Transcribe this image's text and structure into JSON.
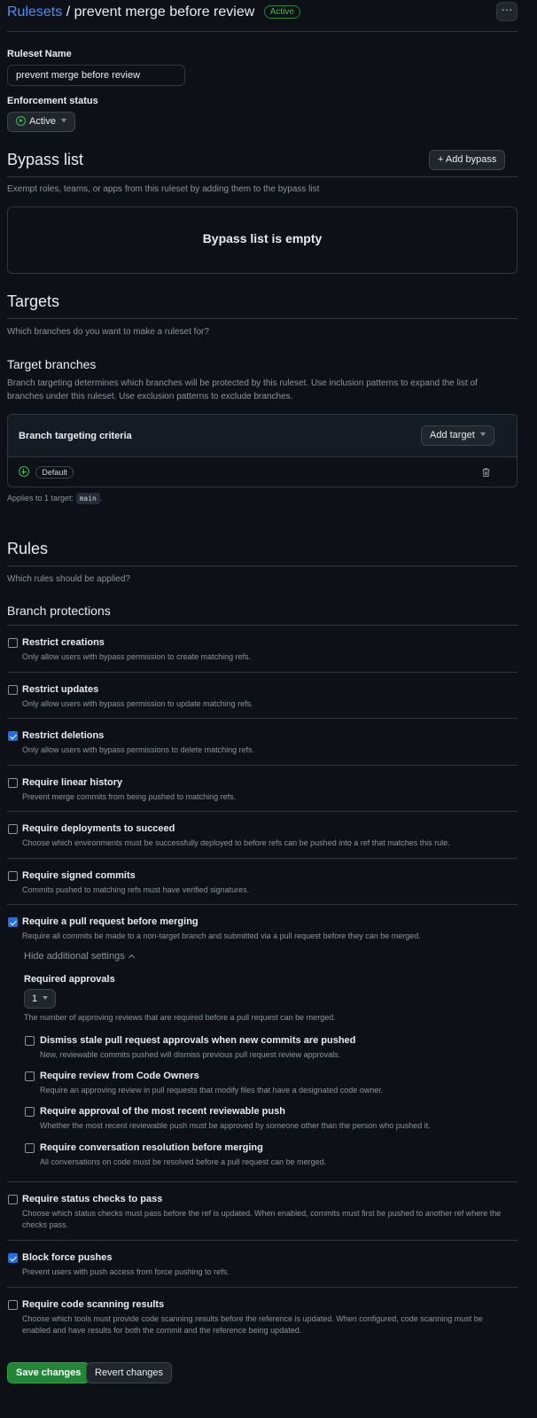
{
  "header": {
    "breadcrumb_link": "Rulesets",
    "separator": "/",
    "ruleset_title": "prevent merge before review",
    "status_badge": "Active",
    "more_icon": "kebab-horizontal-icon"
  },
  "name_section": {
    "label": "Ruleset Name",
    "value": "prevent merge before review"
  },
  "enforcement": {
    "label": "Enforcement status",
    "selected": "Active"
  },
  "bypass": {
    "title": "Bypass list",
    "add_button": "+ Add bypass",
    "description": "Exempt roles, teams, or apps from this ruleset by adding them to the bypass list",
    "empty_text": "Bypass list is empty"
  },
  "targets": {
    "title": "Targets",
    "description": "Which branches do you want to make a ruleset for?",
    "branches_title": "Target branches",
    "branches_description": "Branch targeting determines which branches will be protected by this ruleset. Use inclusion patterns to expand the list of branches under this ruleset. Use exclusion patterns to exclude branches.",
    "criteria_label": "Branch targeting criteria",
    "add_target_button": "Add target",
    "default_pill": "Default",
    "applies_prefix": "Applies to 1 target:",
    "applies_code": "main",
    "applies_suffix": "."
  },
  "rules": {
    "title": "Rules",
    "description": "Which rules should be applied?",
    "protections_title": "Branch protections",
    "items": [
      {
        "title": "Restrict creations",
        "description": "Only allow users with bypass permission to create matching refs.",
        "checked": false
      },
      {
        "title": "Restrict updates",
        "description": "Only allow users with bypass permission to update matching refs.",
        "checked": false
      },
      {
        "title": "Restrict deletions",
        "description": "Only allow users with bypass permissions to delete matching refs.",
        "checked": true
      },
      {
        "title": "Require linear history",
        "description": "Prevent merge commits from being pushed to matching refs.",
        "checked": false
      },
      {
        "title": "Require deployments to succeed",
        "description": "Choose which environments must be successfully deployed to before refs can be pushed into a ref that matches this rule.",
        "checked": false
      },
      {
        "title": "Require signed commits",
        "description": "Commits pushed to matching refs must have verified signatures.",
        "checked": false
      },
      {
        "title": "Require a pull request before merging",
        "description": "Require all commits be made to a non-target branch and submitted via a pull request before they can be merged.",
        "checked": true
      },
      {
        "title": "Require status checks to pass",
        "description": "Choose which status checks must pass before the ref is updated. When enabled, commits must first be pushed to another ref where the checks pass.",
        "checked": false
      },
      {
        "title": "Block force pushes",
        "description": "Prevent users with push access from force pushing to refs.",
        "checked": true
      },
      {
        "title": "Require code scanning results",
        "description": "Choose which tools must provide code scanning results before the reference is updated. When configured, code scanning must be enabled and have results for both the commit and the reference being updated.",
        "checked": false
      }
    ],
    "pr_settings": {
      "toggle_label": "Hide additional settings",
      "approvals_label": "Required approvals",
      "approvals_value": "1",
      "approvals_description": "The number of approving reviews that are required before a pull request can be merged.",
      "sub_items": [
        {
          "title": "Dismiss stale pull request approvals when new commits are pushed",
          "description": "New, reviewable commits pushed will dismiss previous pull request review approvals.",
          "checked": false
        },
        {
          "title": "Require review from Code Owners",
          "description": "Require an approving review in pull requests that modify files that have a designated code owner.",
          "checked": false
        },
        {
          "title": "Require approval of the most recent reviewable push",
          "description": "Whether the most recent reviewable push must be approved by someone other than the person who pushed it.",
          "checked": false
        },
        {
          "title": "Require conversation resolution before merging",
          "description": "All conversations on code must be resolved before a pull request can be merged.",
          "checked": false
        }
      ]
    }
  },
  "footer": {
    "save_button": "Save changes",
    "revert_button": "Revert changes"
  }
}
